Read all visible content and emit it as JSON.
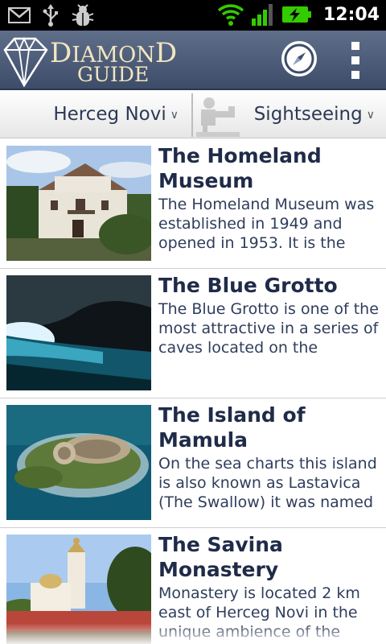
{
  "status_bar": {
    "time": "12:04",
    "icons": [
      "gmail-icon",
      "usb-icon",
      "debug-icon",
      "wifi-icon",
      "signal-icon",
      "battery-charging-icon"
    ]
  },
  "app_bar": {
    "logo_line1_big_d": "D",
    "logo_line1_mid": "IAMON",
    "logo_line1_end_d": "D",
    "logo_line2": "GUIDE",
    "compass_icon": "compass-icon",
    "menu_icon": "overflow-menu-icon"
  },
  "filters": {
    "city": "Herceg Novi",
    "category": "Sightseeing",
    "category_icon": "sightseeing-icon"
  },
  "places": [
    {
      "title": "The Homeland Museum",
      "description": "The Homeland Museum was established in 1949 and opened in 1953. It is the"
    },
    {
      "title": "The Blue Grotto",
      "description": "The Blue Grotto is one of the most attractive in a series of caves located on the"
    },
    {
      "title": "The Island of Mamula",
      "description": "On the sea charts this island is also known as Lastavica (The Swallow) it was named"
    },
    {
      "title": "The Savina Monastery",
      "description": "Monastery is located 2 km east of Herceg Novi in the unique ambience of the"
    }
  ],
  "colors": {
    "header_top": "#5f6f8a",
    "header_bottom": "#3d4c69",
    "title_text": "#1f2b48",
    "logo_text": "#f3e5bf",
    "battery_green": "#33cc00"
  }
}
